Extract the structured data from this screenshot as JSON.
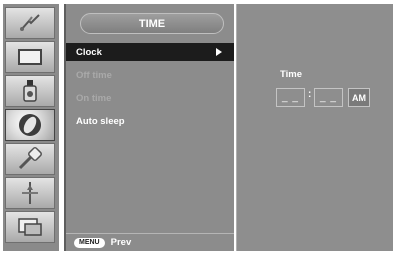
{
  "menu": {
    "title": "TIME",
    "items": [
      {
        "label": "Clock",
        "selected": true
      },
      {
        "label": "Off time",
        "enabled": false
      },
      {
        "label": "On time",
        "enabled": false
      },
      {
        "label": "Auto sleep",
        "enabled": true
      }
    ],
    "footer": {
      "badge": "MENU",
      "label": "Prev"
    }
  },
  "clock_setting": {
    "label": "Time",
    "hour": "_ _",
    "separator": ":",
    "minute": "_ _",
    "period": "AM"
  },
  "icons": [
    "picture-adjust-icon",
    "screen-position-icon",
    "color-bottle-icon",
    "time-clock-icon",
    "tracking-icon",
    "setup-icon",
    "multi-window-icon"
  ],
  "colors": {
    "panel": "#8c8c8c",
    "selected_row": "#1c1c1c",
    "text": "#ffffff"
  }
}
